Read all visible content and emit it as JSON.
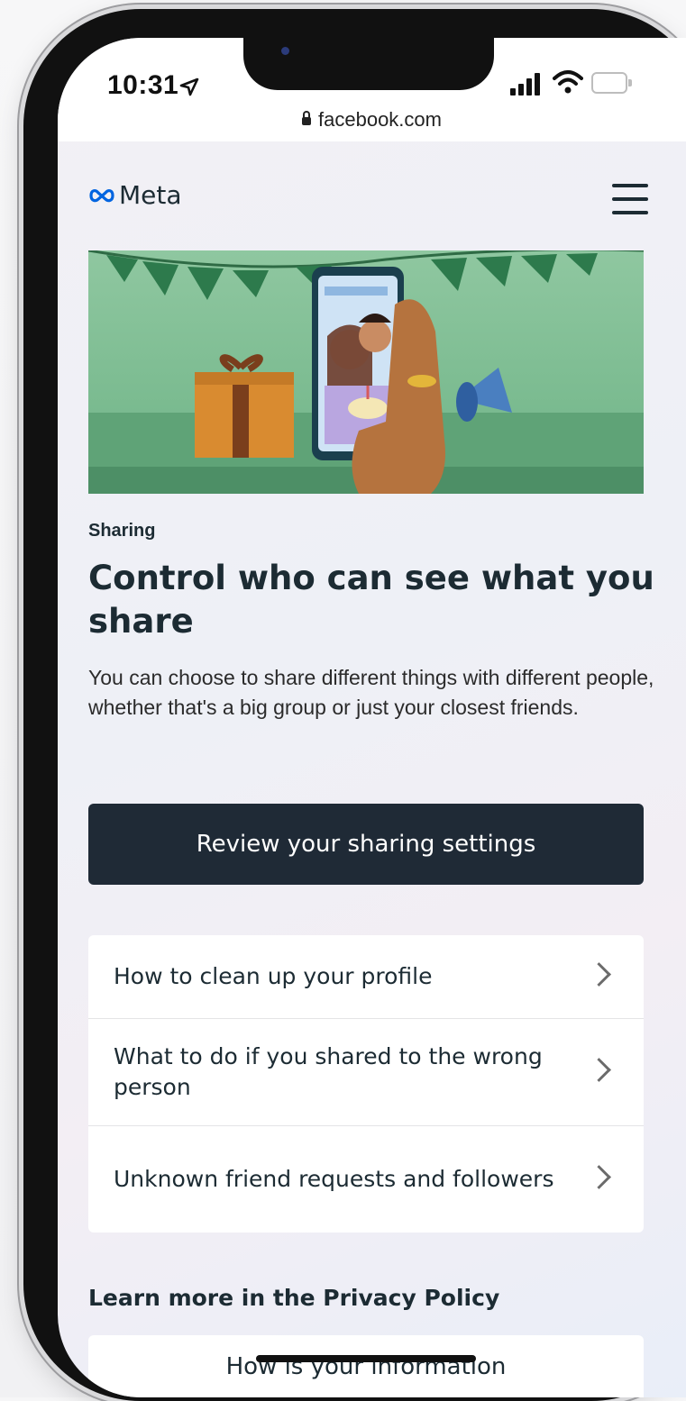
{
  "status_bar": {
    "time": "10:31",
    "url": "facebook.com"
  },
  "header": {
    "logo_text": "Meta",
    "menu_icon": "hamburger-menu-icon"
  },
  "hero": {
    "illustration": "people-sharing-birthday-photo"
  },
  "content": {
    "eyebrow": "Sharing",
    "title": "Control who can see what you share",
    "body": "You can choose to share different things with different people, whether that's a big group or just your closest friends.",
    "cta_label": "Review your sharing settings"
  },
  "links": [
    {
      "label": "How to clean up your profile"
    },
    {
      "label": "What to do if you shared to the wrong person"
    },
    {
      "label": "Unknown friend requests and followers"
    }
  ],
  "privacy": {
    "section_title": "Learn more in the Privacy Policy",
    "card_label": "How is your information"
  },
  "colors": {
    "cta_bg": "#1f2a36",
    "meta_blue": "#0064e0",
    "text": "#1c2b33"
  }
}
